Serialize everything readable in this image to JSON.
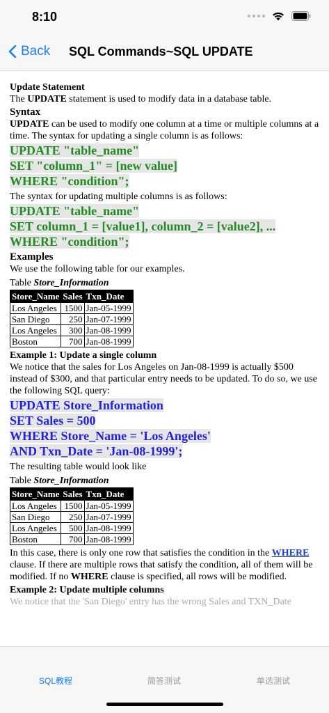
{
  "status": {
    "time": "8:10"
  },
  "nav": {
    "back_label": "Back",
    "title": "SQL Commands~SQL UPDATE"
  },
  "article": {
    "heading": "Update Statement",
    "intro_pre": "The ",
    "intro_kw": "UPDATE",
    "intro_post": " statement is used to modify data in a database table.",
    "syntax_heading": "Syntax",
    "syntax_kw": "UPDATE",
    "syntax_desc": " can be used to modify one column at a time or multiple columns at a time. The syntax for updating a single column is as follows:",
    "code_single": [
      "UPDATE \"table_name\"",
      "SET \"column_1\" = [new value]",
      "WHERE \"condition\";"
    ],
    "multi_desc": "The syntax for updating multiple columns is as follows:",
    "code_multi": [
      "UPDATE \"table_name\"",
      "SET column_1 = [value1], column_2 = [value2], ...",
      "WHERE \"condition\";"
    ],
    "examples_heading": "Examples",
    "examples_desc": "We use the following table for our examples.",
    "table_label": "Table ",
    "table_name": "Store_Information",
    "table_headers": [
      "Store_Name",
      "Sales",
      "Txn_Date"
    ],
    "table1_rows": [
      [
        "Los Angeles",
        "1500",
        "Jan-05-1999"
      ],
      [
        "San Diego",
        "250",
        "Jan-07-1999"
      ],
      [
        "Los Angeles",
        "300",
        "Jan-08-1999"
      ],
      [
        "Boston",
        "700",
        "Jan-08-1999"
      ]
    ],
    "example1_heading": "Example 1: Update a single column",
    "example1_desc": "We notice that the sales for Los Angeles on Jan-08-1999 is actually $500 instead of $300, and that particular entry needs to be updated. To do so, we use the following SQL query:",
    "code_example1": [
      "UPDATE Store_Information",
      "SET Sales = 500",
      "WHERE Store_Name = 'Los Angeles'",
      "AND Txn_Date = 'Jan-08-1999';"
    ],
    "result_desc": "The resulting table would look like",
    "table2_rows": [
      [
        "Los Angeles",
        "1500",
        "Jan-05-1999"
      ],
      [
        "San Diego",
        "250",
        "Jan-07-1999"
      ],
      [
        "Los Angeles",
        "500",
        "Jan-08-1999"
      ],
      [
        "Boston",
        "700",
        "Jan-08-1999"
      ]
    ],
    "closing_pre": "In this case, there is only one row that satisfies the condition in the ",
    "closing_link": "WHERE",
    "closing_mid": " clause. If there are multiple rows that satisfy the condition, all of them will be modified. If no ",
    "closing_kw": "WHERE",
    "closing_post": " clause is specified, all rows will be modified.",
    "example2_heading": "Example 2: Update multiple columns",
    "example2_partial": "We notice that the 'San Diego' entry has the wrong Sales and TXN_Date"
  },
  "tabs": [
    {
      "label": "SQL教程",
      "active": true
    },
    {
      "label": "简答测试",
      "active": false
    },
    {
      "label": "单选测试",
      "active": false
    }
  ],
  "colors": {
    "accent": "#1a7ff5",
    "code_green": "#228b22",
    "code_blue": "#2222dd"
  }
}
